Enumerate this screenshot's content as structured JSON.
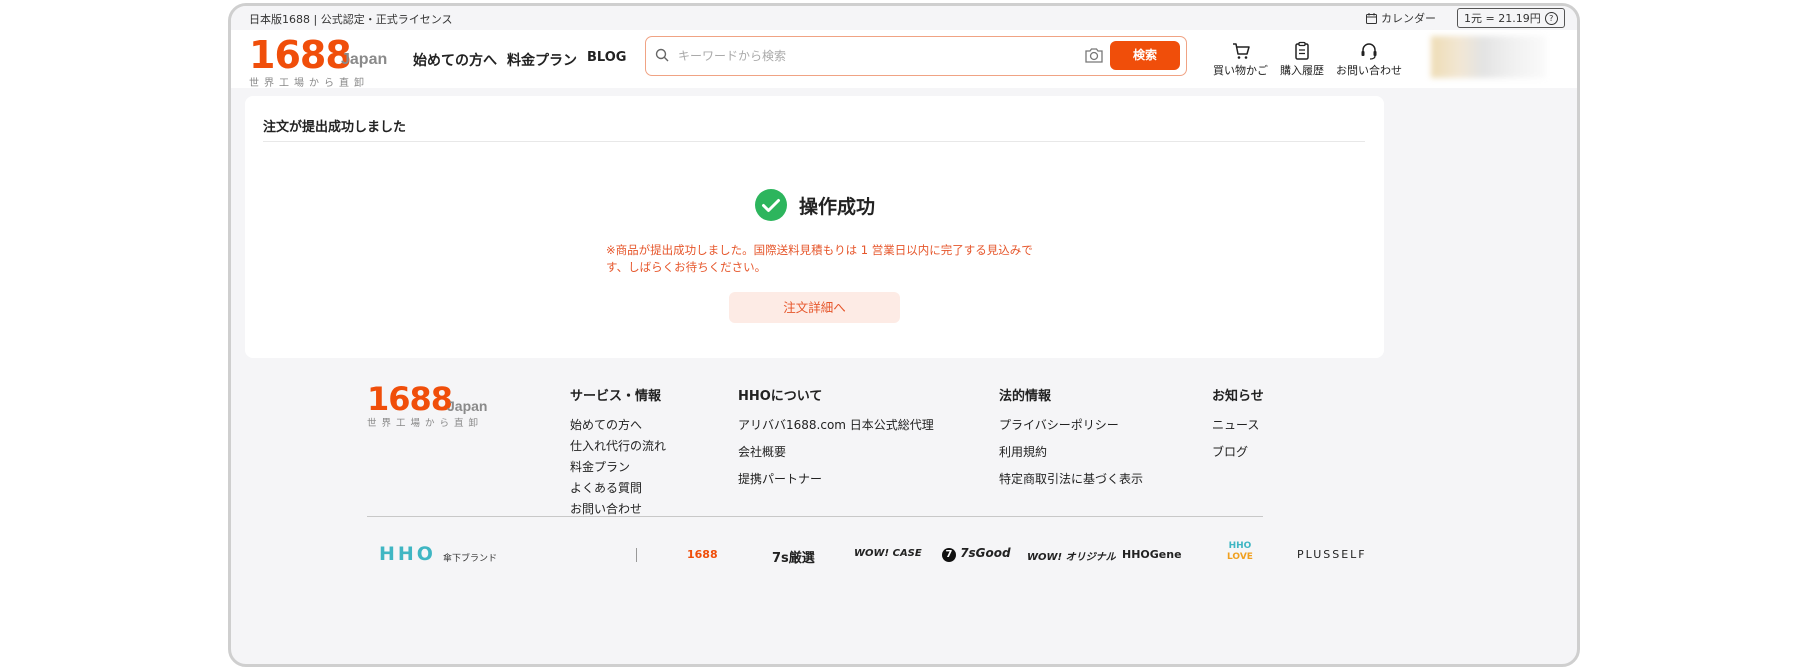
{
  "topbar": {
    "license": "日本版1688 | 公式認定・正式ライセンス",
    "calendar_label": "カレンダー",
    "rate": "1元 = 21.19円"
  },
  "header": {
    "logo_num": "1688",
    "logo_suffix": "Japan",
    "logo_tagline": "世界工場から直卸",
    "nav": [
      "始めての方へ",
      "料金プラン",
      "BLOG"
    ],
    "search_placeholder": "キーワードから検索",
    "search_button": "検索",
    "icons": {
      "cart": "買い物かご",
      "history": "購入履歴",
      "contact": "お問い合わせ"
    }
  },
  "card": {
    "title": "注文が提出成功しました",
    "success_title": "操作成功",
    "notice": "※商品が提出成功しました。国際送料見積もりは 1 営業日以内に完了する見込みです、しばらくお待ちください。",
    "detail_button": "注文詳細へ"
  },
  "footer": {
    "logo_num": "1688",
    "logo_suffix": "Japan",
    "logo_tagline": "世界工場から直卸",
    "services": {
      "heading": "サービス・情報",
      "items": [
        "始めての方へ",
        "仕入れ代行の流れ",
        "料金プラン",
        "よくある質問",
        "お問い合わせ"
      ]
    },
    "about": {
      "heading": "HHOについて",
      "items": [
        "アリババ1688.com 日本公式総代理",
        "会社概要",
        "提携パートナー"
      ]
    },
    "legal": {
      "heading": "法的情報",
      "items": [
        "プライバシーポリシー",
        "利用規約",
        "特定商取引法に基づく表示"
      ]
    },
    "news": {
      "heading": "お知らせ",
      "items": [
        "ニュース",
        "ブログ"
      ]
    },
    "brands": {
      "hho": "HHO",
      "umbrella": "傘下ブランド",
      "b1688": "1688",
      "b7s": "7s厳選",
      "wowcase": "WOW! CASE",
      "tsgood": "7sGood",
      "wowori": "WOW! オリジナル",
      "hhogene": "HHOGene",
      "hholove_top": "HHO",
      "hholove_bottom": "LOVE",
      "plusself": "PLUSSELF"
    }
  },
  "colors": {
    "brand_orange": "#f04e0a",
    "success_green": "#2db55d",
    "notice_red": "#e6562b"
  }
}
